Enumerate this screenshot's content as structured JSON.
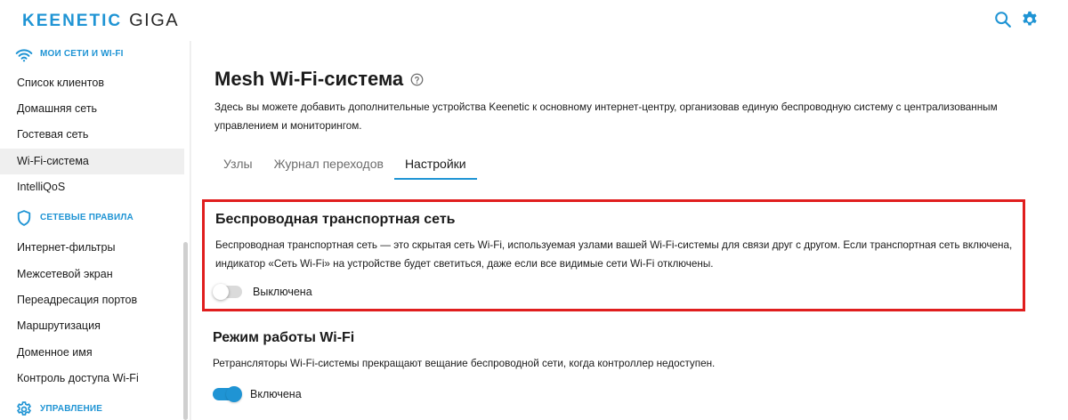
{
  "header": {
    "brand": "KEENETIC",
    "model": "GIGA",
    "search_icon": "search-icon",
    "settings_icon": "gear-icon",
    "accent_color": "#1f94d4"
  },
  "sidebar": {
    "sections": [
      {
        "title": "МОИ СЕТИ И WI-FI",
        "icon": "wifi-icon"
      },
      {
        "title": "СЕТЕВЫЕ ПРАВИЛА",
        "icon": "shield-icon"
      },
      {
        "title": "УПРАВЛЕНИЕ",
        "icon": "gear-icon"
      }
    ],
    "items": [
      {
        "label": "Список клиентов"
      },
      {
        "label": "Домашняя сеть"
      },
      {
        "label": "Гостевая сеть"
      },
      {
        "label": "Wi-Fi-система",
        "active": true
      },
      {
        "label": "IntelliQoS"
      },
      {
        "label": "Интернет-фильтры"
      },
      {
        "label": "Межсетевой экран"
      },
      {
        "label": "Переадресация портов"
      },
      {
        "label": "Маршрутизация"
      },
      {
        "label": "Доменное имя"
      },
      {
        "label": "Контроль доступа Wi-Fi"
      }
    ]
  },
  "main": {
    "title": "Mesh Wi-Fi-система",
    "help_icon": "question-circle-icon",
    "description": "Здесь вы можете добавить дополнительные устройства Keenetic к основному интернет-центру, организовав единую беспроводную систему с централизованным управлением и мониторингом.",
    "tabs": [
      {
        "label": "Узлы",
        "active": false
      },
      {
        "label": "Журнал переходов",
        "active": false
      },
      {
        "label": "Настройки",
        "active": true
      }
    ],
    "backhaul": {
      "title": "Беспроводная транспортная сеть",
      "description": "Беспроводная транспортная сеть — это скрытая сеть Wi-Fi, используемая узлами вашей Wi-Fi-системы для связи друг с другом. Если транспортная сеть включена, индикатор «Сеть Wi-Fi» на устройстве будет светиться, даже если все видимые сети Wi-Fi отключены.",
      "toggle_state": false,
      "toggle_label": "Выключена",
      "highlight_color": "#e01e1e"
    },
    "wifi_mode": {
      "title": "Режим работы Wi-Fi",
      "description": "Ретрансляторы Wi-Fi-системы прекращают вещание беспроводной сети, когда контроллер недоступен.",
      "toggle_state": true,
      "toggle_label": "Включена"
    }
  }
}
